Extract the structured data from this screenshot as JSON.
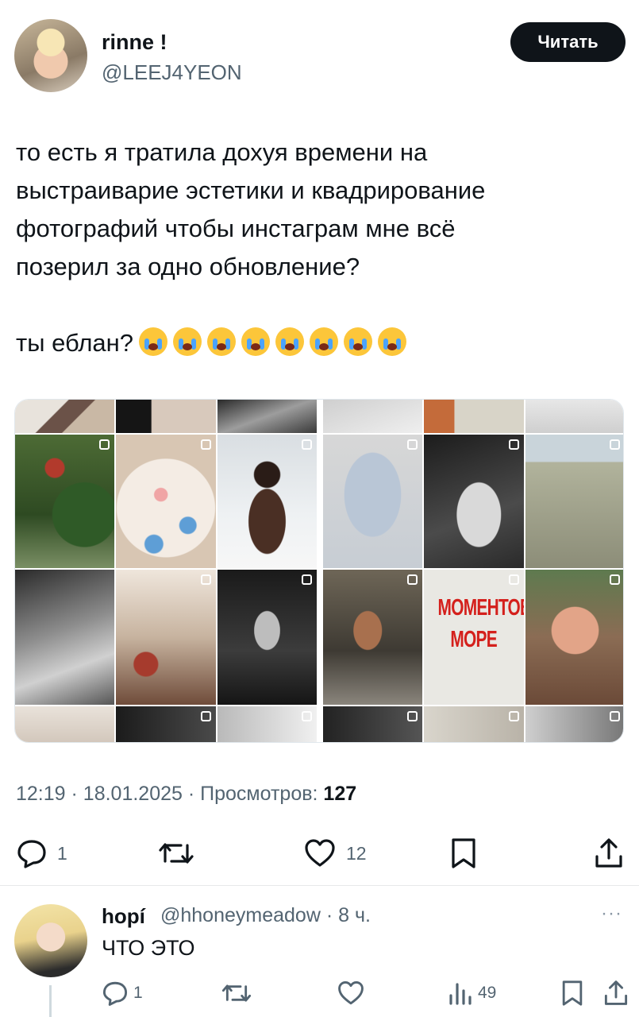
{
  "author": {
    "name": "rinne !",
    "handle": "@LEEJ4YEON",
    "follow_label": "Читать"
  },
  "tweet": {
    "line1": "то есть я тратила дохуя времени на",
    "line2": "выстраиварие эстетики и квадрирование",
    "line3": "фотографий чтобы инстаграм мне всё",
    "line4": "позерил за одно обновление?",
    "line5": "ты еблан?",
    "emoji_count": 8,
    "emoji_name": "loudly-crying-face"
  },
  "media": {
    "poster_line1": "МОМЕНТОВ",
    "poster_line2": "МОРЕ"
  },
  "meta": {
    "time": "12:19",
    "date": "18.01.2025",
    "views_label": "Просмотров:",
    "views_count": "127"
  },
  "actions": {
    "replies": "1",
    "likes": "12",
    "icons": [
      "reply-icon",
      "retweet-icon",
      "like-icon",
      "bookmark-icon",
      "share-icon"
    ]
  },
  "reply": {
    "name": "hopí",
    "handle_time": "@hhoneymeadow · 8 ч.",
    "text": "ЧТО ЭТО",
    "more": "···",
    "replies": "1",
    "views": "49"
  },
  "colors": {
    "text": "#0f1419",
    "secondary": "#536471",
    "button_bg": "#0f1419"
  }
}
